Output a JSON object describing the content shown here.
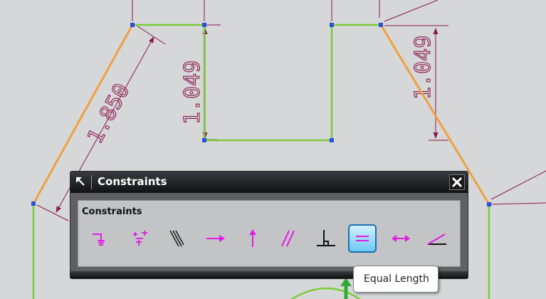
{
  "sketch": {
    "dimensions": [
      "1.850",
      "1.049",
      "1.049"
    ],
    "colors": {
      "background": "#d6d7d9",
      "line_green": "#7ccc39",
      "line_orange": "#f0a040",
      "dimension": "#8a1a4a",
      "vertex": "#2a4fd8"
    }
  },
  "dialog": {
    "title": "Constraints",
    "grip_icon": "reset-arrow-icon",
    "close_icon": "close-icon",
    "section_title": "Constraints",
    "tools": [
      {
        "name": "point-on-curve",
        "icon": "point-on-curve-icon"
      },
      {
        "name": "midpoint",
        "icon": "midpoint-icon"
      },
      {
        "name": "collinear",
        "icon": "collinear-icon"
      },
      {
        "name": "horizontal",
        "icon": "horizontal-icon"
      },
      {
        "name": "vertical",
        "icon": "vertical-icon"
      },
      {
        "name": "parallel",
        "icon": "parallel-icon"
      },
      {
        "name": "perpendicular",
        "icon": "perpendicular-icon"
      },
      {
        "name": "equal-length",
        "icon": "equal-length-icon",
        "active": true
      },
      {
        "name": "constant-length",
        "icon": "constant-length-icon"
      },
      {
        "name": "constant-angle",
        "icon": "constant-angle-icon"
      }
    ]
  },
  "tooltip": {
    "text": "Equal Length"
  }
}
